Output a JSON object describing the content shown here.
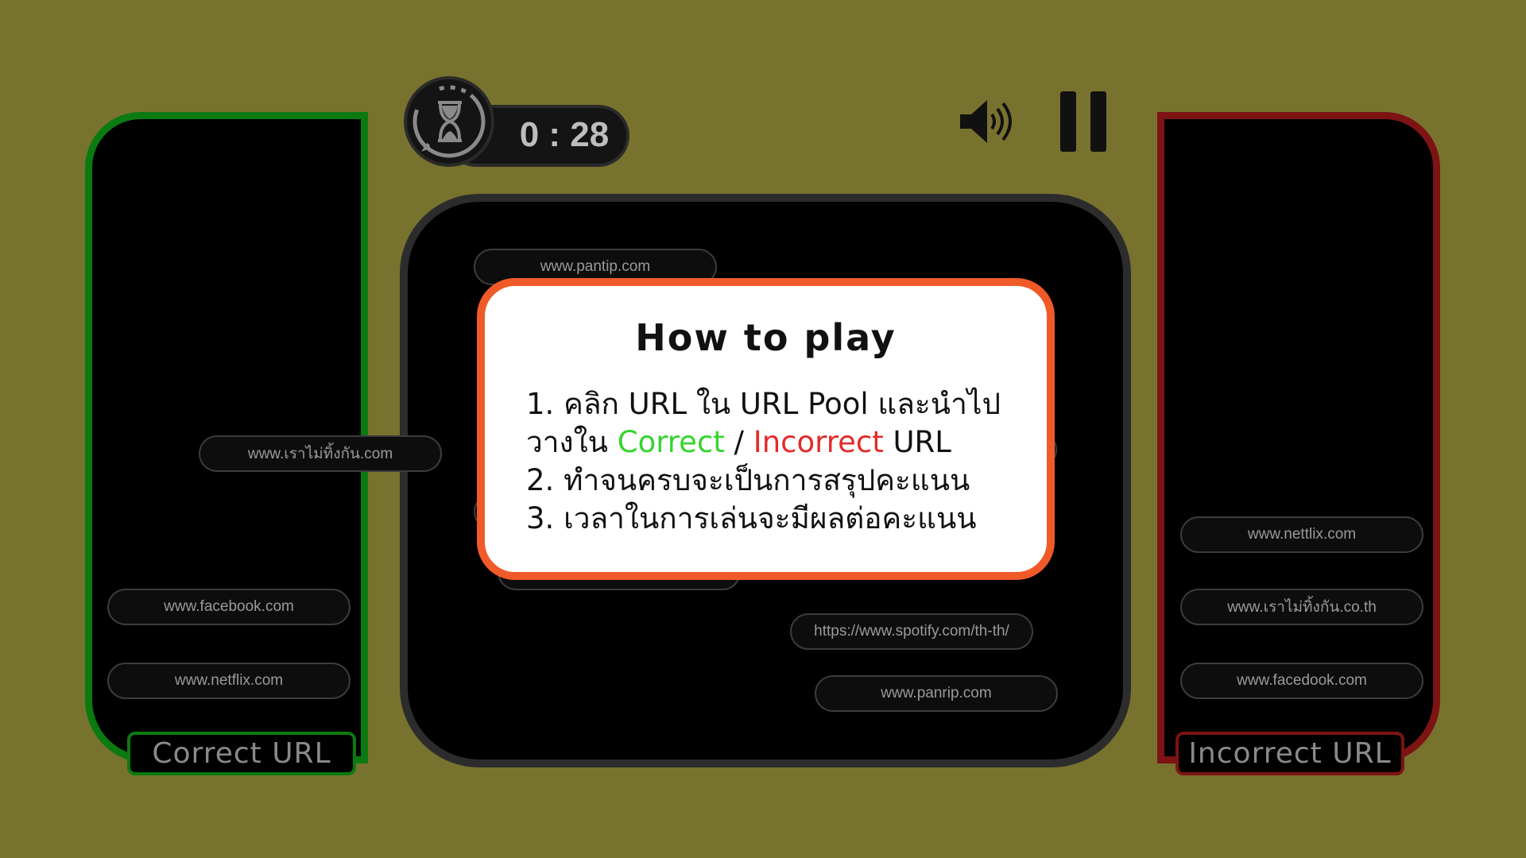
{
  "timer": {
    "display": "0 : 28"
  },
  "controls": {
    "sound_icon": "speaker-icon",
    "pause_icon": "pause-icon",
    "timer_icon": "hourglass-icon"
  },
  "bins": {
    "correct": {
      "label": "Correct URL",
      "color": "#0b7a10"
    },
    "incorrect": {
      "label": "Incorrect URL",
      "color": "#7d1313"
    }
  },
  "urls": {
    "pool_top": "www.pantip.com",
    "dragging": "www.เราไม่ทิ้งกัน.com",
    "pool_spotify": "https://www.spotify.com/th-th/",
    "pool_panrip": "www.panrip.com",
    "correct_facebook": "www.facebook.com",
    "correct_netflix": "www.netflix.com",
    "incorrect_nettlix": "www.nettlix.com",
    "incorrect_thai": "www.เราไม่ทิ้งกัน.co.th",
    "incorrect_facedook": "www.facedook.com"
  },
  "dialog": {
    "title": "How to play",
    "line1": "1. คลิก URL ใน URL Pool และนำไป",
    "line2_prefix": "วางใน ",
    "line2_correct": "Correct",
    "line2_sep": " / ",
    "line2_incorrect": "Incorrect",
    "line2_suffix": " URL",
    "line3": "2. ทำจนครบจะเป็นการสรุปคะแนน",
    "line4": "3. เวลาในการเล่นจะมีผลต่อคะแนน",
    "border_color": "#f05a28"
  },
  "colors": {
    "background": "#78722f",
    "correct_accent": "#36d42f",
    "incorrect_accent": "#e32b2b"
  }
}
